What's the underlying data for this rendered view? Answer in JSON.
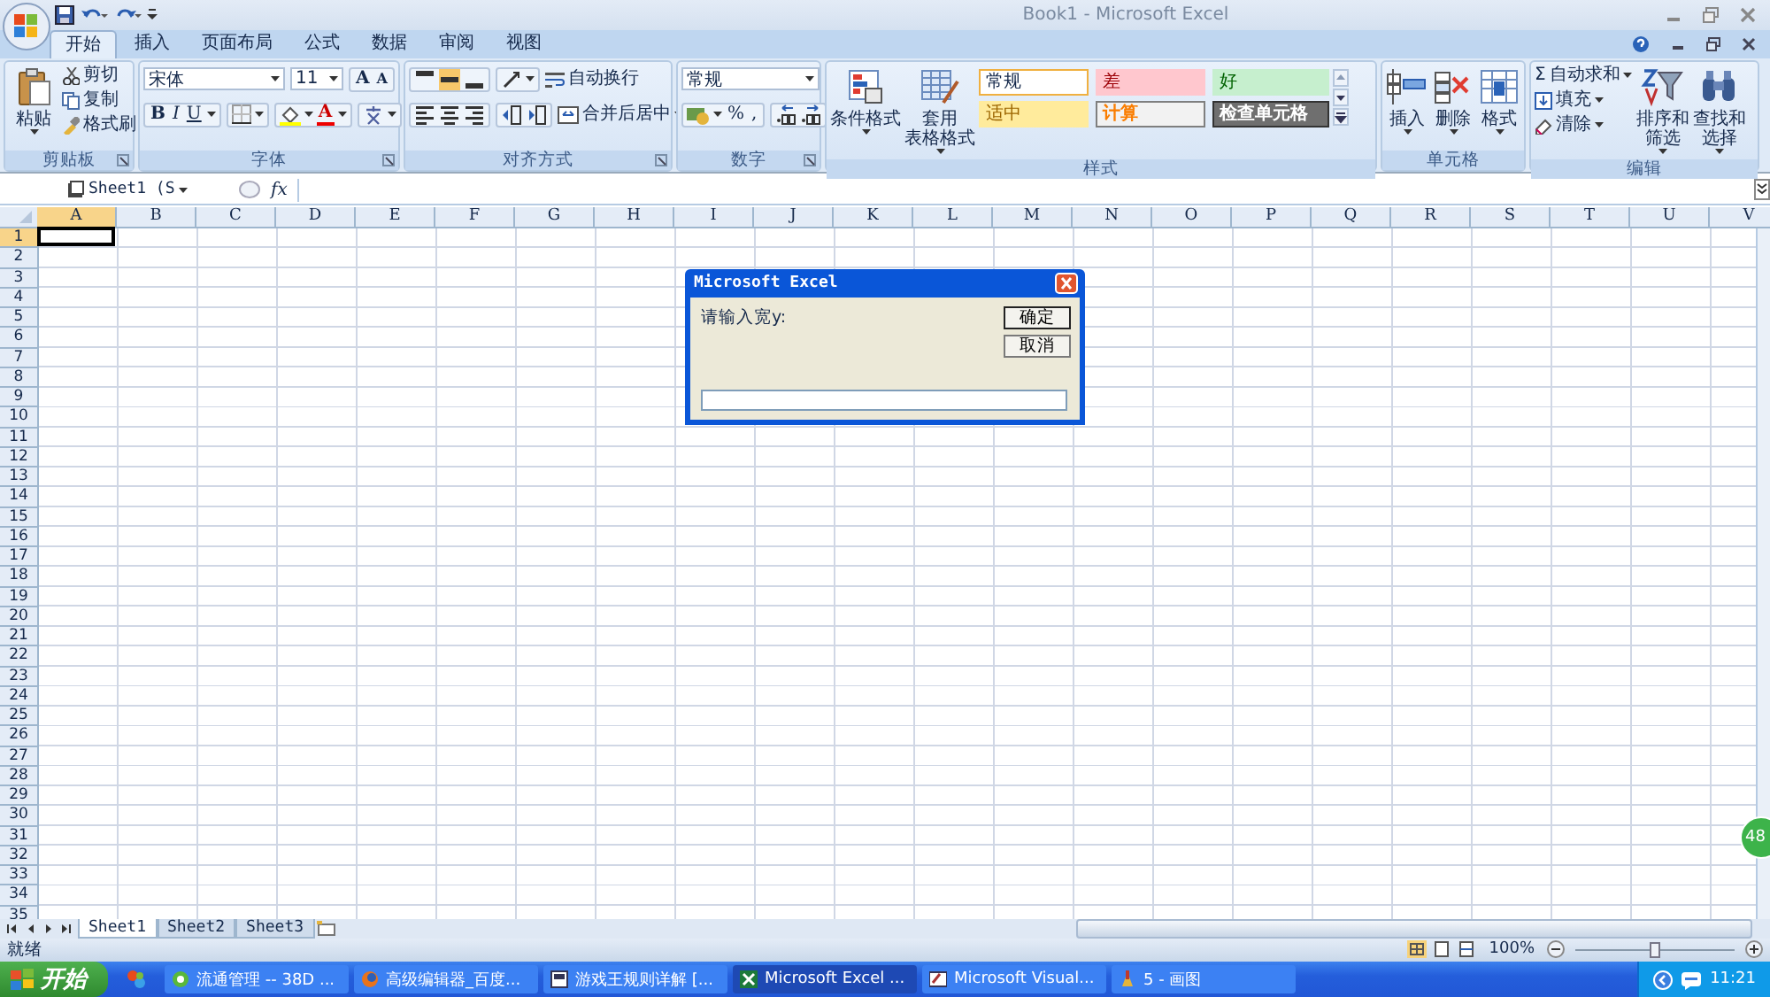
{
  "title_bar": {
    "title": "Book1 - Microsoft Excel"
  },
  "ribbon_tabs": [
    {
      "label": "开始",
      "selected": true
    },
    {
      "label": "插入",
      "selected": false
    },
    {
      "label": "页面布局",
      "selected": false
    },
    {
      "label": "公式",
      "selected": false
    },
    {
      "label": "数据",
      "selected": false
    },
    {
      "label": "审阅",
      "selected": false
    },
    {
      "label": "视图",
      "selected": false
    }
  ],
  "clipboard": {
    "paste": "粘贴",
    "actions": [
      "剪切",
      "复制",
      "格式刷"
    ],
    "label": "剪贴板"
  },
  "font": {
    "font_name": "宋体",
    "font_size": "11",
    "size_buttons": [
      "A",
      "A"
    ],
    "style_buttons": [
      "B",
      "I",
      "U"
    ],
    "color_button": "A",
    "label": "字体"
  },
  "alignment": {
    "wrap_text": "自动换行",
    "merge_center": "合并后居中",
    "label": "对齐方式"
  },
  "number": {
    "format": "常规",
    "percent": "%",
    "comma": ",",
    "label": "数字"
  },
  "styles": {
    "buttons": [
      [
        "条件格式"
      ],
      [
        "套用",
        "表格格式"
      ]
    ],
    "cell_styles": [
      {
        "label": "常规",
        "kind": "normal"
      },
      {
        "label": "差",
        "kind": "bad"
      },
      {
        "label": "好",
        "kind": "good"
      },
      {
        "label": "适中",
        "kind": "neutral"
      },
      {
        "label": "计算",
        "kind": "calculation"
      },
      {
        "label": "检查单元格",
        "kind": "check"
      }
    ],
    "label": "样式"
  },
  "cells": {
    "buttons": [
      "插入",
      "删除",
      "格式"
    ],
    "label": "单元格"
  },
  "editing": {
    "sum_sign": "Σ",
    "actions": [
      "自动求和",
      "填充",
      "清除"
    ],
    "buttons": [
      [
        "排序和",
        "筛选"
      ],
      [
        "查找和",
        "选择"
      ]
    ],
    "label": "编辑"
  },
  "formula_bar": {
    "name_box": "Sheet1 (S",
    "fx": "fx"
  },
  "grid": {
    "columns": [
      {
        "label": "A",
        "selected": true
      },
      {
        "label": "B",
        "selected": false
      },
      {
        "label": "C",
        "selected": false
      },
      {
        "label": "D",
        "selected": false
      },
      {
        "label": "E",
        "selected": false
      },
      {
        "label": "F",
        "selected": false
      },
      {
        "label": "G",
        "selected": false
      },
      {
        "label": "H",
        "selected": false
      },
      {
        "label": "I",
        "selected": false
      },
      {
        "label": "J",
        "selected": false
      },
      {
        "label": "K",
        "selected": false
      },
      {
        "label": "L",
        "selected": false
      },
      {
        "label": "M",
        "selected": false
      },
      {
        "label": "N",
        "selected": false
      },
      {
        "label": "O",
        "selected": false
      },
      {
        "label": "P",
        "selected": false
      },
      {
        "label": "Q",
        "selected": false
      },
      {
        "label": "R",
        "selected": false
      },
      {
        "label": "S",
        "selected": false
      },
      {
        "label": "T",
        "selected": false
      },
      {
        "label": "U",
        "selected": false
      },
      {
        "label": "V",
        "selected": false
      }
    ],
    "rows": [
      {
        "label": "1",
        "selected": true
      },
      {
        "label": "2",
        "selected": false
      },
      {
        "label": "3",
        "selected": false
      },
      {
        "label": "4",
        "selected": false
      },
      {
        "label": "5",
        "selected": false
      },
      {
        "label": "6",
        "selected": false
      },
      {
        "label": "7",
        "selected": false
      },
      {
        "label": "8",
        "selected": false
      },
      {
        "label": "9",
        "selected": false
      },
      {
        "label": "10",
        "selected": false
      },
      {
        "label": "11",
        "selected": false
      },
      {
        "label": "12",
        "selected": false
      },
      {
        "label": "13",
        "selected": false
      },
      {
        "label": "14",
        "selected": false
      },
      {
        "label": "15",
        "selected": false
      },
      {
        "label": "16",
        "selected": false
      },
      {
        "label": "17",
        "selected": false
      },
      {
        "label": "18",
        "selected": false
      },
      {
        "label": "19",
        "selected": false
      },
      {
        "label": "20",
        "selected": false
      },
      {
        "label": "21",
        "selected": false
      },
      {
        "label": "22",
        "selected": false
      },
      {
        "label": "23",
        "selected": false
      },
      {
        "label": "24",
        "selected": false
      },
      {
        "label": "25",
        "selected": false
      },
      {
        "label": "26",
        "selected": false
      },
      {
        "label": "27",
        "selected": false
      },
      {
        "label": "28",
        "selected": false
      },
      {
        "label": "29",
        "selected": false
      },
      {
        "label": "30",
        "selected": false
      },
      {
        "label": "31",
        "selected": false
      },
      {
        "label": "32",
        "selected": false
      },
      {
        "label": "33",
        "selected": false
      },
      {
        "label": "34",
        "selected": false
      },
      {
        "label": "35",
        "selected": false
      }
    ]
  },
  "dialog": {
    "title": "Microsoft Excel",
    "prompt": "请输入宽y:",
    "buttons": [
      "确定",
      "取消"
    ]
  },
  "sheet_tabs": [
    {
      "label": "Sheet1",
      "selected": true
    },
    {
      "label": "Sheet2",
      "selected": false
    },
    {
      "label": "Sheet3",
      "selected": false
    }
  ],
  "status_bar": {
    "status": "就绪",
    "zoom": "100%",
    "zoom_slider": {
      "level": 0.5
    }
  },
  "side_badge": "48",
  "taskbar": {
    "start": "开始",
    "items": [
      {
        "label": "流通管理 -- 38D ...",
        "selected": false
      },
      {
        "label": "高级编辑器_百度...",
        "selected": false
      },
      {
        "label": "游戏王规则详解 [...",
        "selected": false
      },
      {
        "label": "Microsoft Excel ...",
        "selected": true
      },
      {
        "label": "Microsoft Visual...",
        "selected": false
      },
      {
        "label": "5 - 画图",
        "selected": false
      }
    ],
    "clock": "11:21"
  }
}
